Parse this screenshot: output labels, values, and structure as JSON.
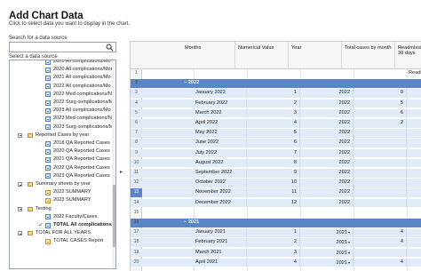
{
  "dialog": {
    "title": "Add Chart Data",
    "subtitle": "Click to select data you want to display in the chart.",
    "search_label": "Search for a data source",
    "search_placeholder": "",
    "select_label": "Select a data source"
  },
  "tree": [
    {
      "text": "2020 All complications/Mo",
      "icon": "sheet",
      "level": 2
    },
    {
      "text": "2020 All complications/Mor",
      "icon": "sheet",
      "level": 2
    },
    {
      "text": "2021 All complications/Mo",
      "icon": "sheet",
      "level": 2
    },
    {
      "text": "2022 All complications/Mo",
      "icon": "sheet",
      "level": 2
    },
    {
      "text": "2022 Med complications/N",
      "icon": "sheet",
      "level": 2
    },
    {
      "text": "2022 Surg complications/M",
      "icon": "sheet",
      "level": 2
    },
    {
      "text": "2023 All complications/Mo",
      "icon": "sheet",
      "level": 2
    },
    {
      "text": "2023 Med complications/N",
      "icon": "sheet",
      "level": 2
    },
    {
      "text": "2023 Surg complications/M",
      "icon": "sheet",
      "level": 2
    },
    {
      "text": "Reported Cases by year",
      "icon": "folder",
      "level": 1,
      "toggle": true
    },
    {
      "text": "2018 QA Reported Cases",
      "icon": "sheet",
      "level": 2
    },
    {
      "text": "2020 QA Reported Cases",
      "icon": "sheet",
      "level": 2
    },
    {
      "text": "2021 QA Reported Cases",
      "icon": "sheet",
      "level": 2
    },
    {
      "text": "2022 QA Reported Cases",
      "icon": "sheet",
      "level": 2
    },
    {
      "text": "2023 QA Reported Cases",
      "icon": "sheet",
      "level": 2
    },
    {
      "text": "Summary sheets by year",
      "icon": "folder",
      "level": 1,
      "toggle": true
    },
    {
      "text": "2022 SUMMARY",
      "icon": "sheet-orange",
      "level": 2
    },
    {
      "text": "2023 SUMMARY",
      "icon": "sheet-orange",
      "level": 2
    },
    {
      "text": "Testing",
      "icon": "folder",
      "level": 1,
      "toggle": true
    },
    {
      "text": "2022 Faculty/Cases",
      "icon": "sheet",
      "level": 2
    },
    {
      "text": "TOTAL All complications/N",
      "icon": "sheet",
      "level": 2,
      "checked": true,
      "bold": true
    },
    {
      "text": "TOTAL FOR ALL YEARS",
      "icon": "folder",
      "level": 1,
      "toggle": true
    },
    {
      "text": "TOTAL CASES Report",
      "icon": "sheet-orange",
      "level": 2
    }
  ],
  "expand_arrow": "▸",
  "columns": [
    "Months",
    "Numerical Value",
    "Year",
    "Total cases by month",
    "Readmission 30 days"
  ],
  "rows": [
    {
      "num": "1",
      "type": "plain",
      "cells": [
        "",
        "",
        "",
        "",
        "Readmissio"
      ]
    },
    {
      "num": "2",
      "type": "group",
      "cells": [
        "2022",
        "",
        "",
        "",
        ""
      ]
    },
    {
      "num": "3",
      "type": "data",
      "cells": [
        "January 2022",
        "1",
        "2022",
        "0",
        ""
      ]
    },
    {
      "num": "4",
      "type": "data",
      "cells": [
        "February 2022",
        "2",
        "2022",
        "5",
        ""
      ]
    },
    {
      "num": "5",
      "type": "data",
      "cells": [
        "March 2022",
        "3",
        "2022",
        "6",
        ""
      ]
    },
    {
      "num": "6",
      "type": "data",
      "cells": [
        "April 2022",
        "4",
        "2022",
        "2",
        ""
      ]
    },
    {
      "num": "7",
      "type": "data",
      "cells": [
        "May 2022",
        "5",
        "2022",
        "",
        ""
      ]
    },
    {
      "num": "8",
      "type": "data",
      "cells": [
        "June 2022",
        "6",
        "2022",
        "",
        ""
      ]
    },
    {
      "num": "9",
      "type": "data",
      "cells": [
        "July 2022",
        "7",
        "2022",
        "",
        ""
      ]
    },
    {
      "num": "10",
      "type": "data",
      "cells": [
        "August 2022",
        "8",
        "2022",
        "",
        ""
      ]
    },
    {
      "num": "11",
      "type": "data",
      "cells": [
        "September 2022",
        "9",
        "2022",
        "",
        ""
      ]
    },
    {
      "num": "12",
      "type": "data",
      "cells": [
        "October 2022",
        "10",
        "2022",
        "",
        ""
      ]
    },
    {
      "num": "13",
      "type": "data",
      "selected": true,
      "cells": [
        "November 2022",
        "11",
        "2022",
        "",
        ""
      ]
    },
    {
      "num": "14",
      "type": "data",
      "cells": [
        "December 2022",
        "12",
        "2022",
        "",
        ""
      ]
    },
    {
      "num": "15",
      "type": "plain",
      "cells": [
        "",
        "",
        "",
        "",
        ""
      ]
    },
    {
      "num": "16",
      "type": "group",
      "cells": [
        "2021",
        "",
        "",
        "",
        ""
      ]
    },
    {
      "num": "17",
      "type": "data",
      "cells": [
        "January 2021",
        "1",
        "2021",
        "4",
        ""
      ]
    },
    {
      "num": "18",
      "type": "data",
      "cells": [
        "February 2021",
        "2",
        "2021",
        "4",
        ""
      ]
    },
    {
      "num": "19",
      "type": "data",
      "cells": [
        "March 2021",
        "3",
        "2021",
        "",
        ""
      ]
    },
    {
      "num": "20",
      "type": "data",
      "cells": [
        "April 2021",
        "4",
        "2021",
        "4",
        ""
      ]
    }
  ]
}
